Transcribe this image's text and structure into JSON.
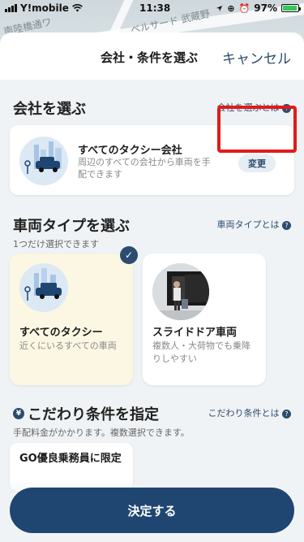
{
  "status_bar": {
    "carrier": "Y!mobile",
    "time": "11:38",
    "battery": "97%"
  },
  "map": {
    "labels": [
      "南陸橋通ワ",
      "ベルサード 武蔵野"
    ]
  },
  "header": {
    "title": "会社・条件を選ぶ",
    "cancel_label": "キャンセル"
  },
  "company_section": {
    "title": "会社を選ぶ",
    "link": "会社を選ぶとは",
    "card": {
      "name": "すべてのタクシー会社",
      "description": "周辺のすべての会社から車両を手配できます",
      "change_label": "変更"
    }
  },
  "vehicle_section": {
    "title": "車両タイプを選ぶ",
    "link": "車両タイプとは",
    "subtitle": "1つだけ選択できます",
    "types": [
      {
        "name": "すべてのタクシー",
        "description": "近くにいるすべての車両",
        "selected": true
      },
      {
        "name": "スライドドア車両",
        "description": "複数人・大荷物でも乗降りしやすい",
        "selected": false
      }
    ]
  },
  "preference_section": {
    "title": "こだわり条件を指定",
    "link": "こだわり条件とは",
    "subtitle": "手配料金がかかります。複数選択できます。",
    "options": [
      {
        "label": "GO優良乗務員に限定"
      }
    ]
  },
  "footer": {
    "decide_label": "決定する"
  },
  "colors": {
    "accent": "#1f4670",
    "link": "#2b4c6f",
    "highlight": "#e11b1b",
    "selected_card": "#fbf7e3"
  }
}
